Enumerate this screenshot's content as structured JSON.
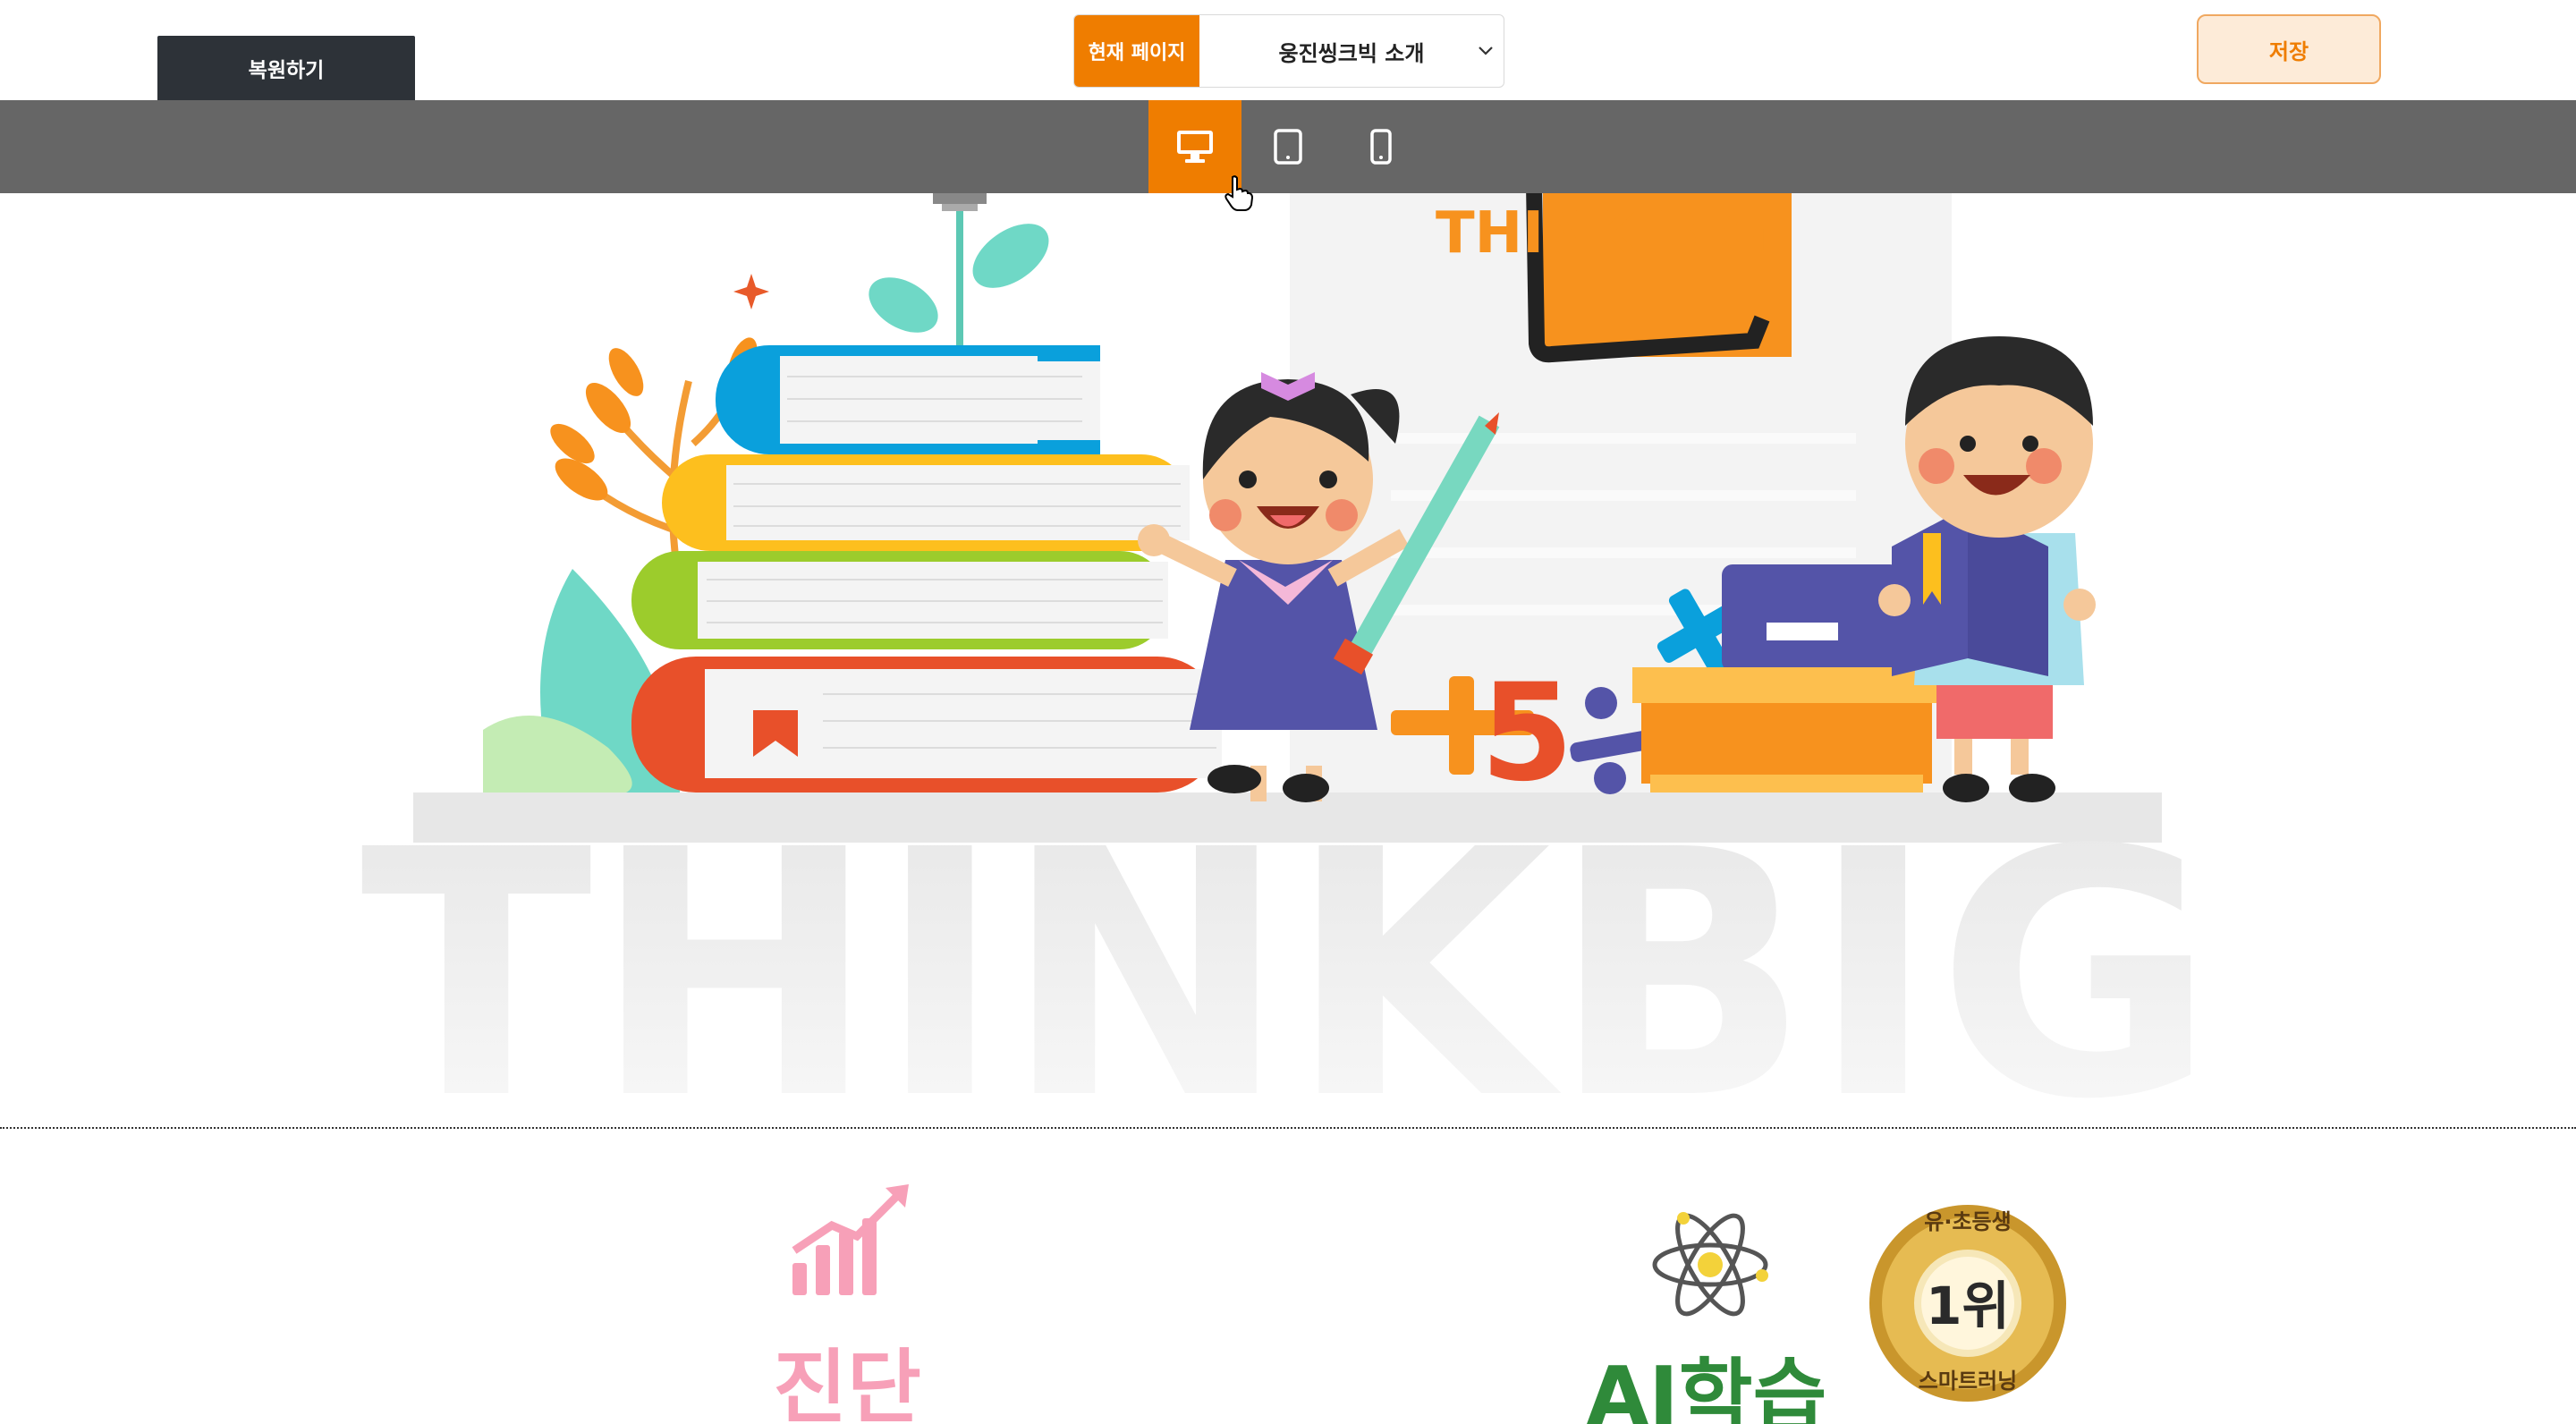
{
  "toolbar": {
    "restore_label": "복원하기",
    "current_page_label": "현재 페이지",
    "current_page_value": "웅진씽크빅 소개",
    "save_label": "저장"
  },
  "device_switcher": {
    "active": "desktop",
    "items": [
      {
        "name": "desktop",
        "icon": "desktop-icon"
      },
      {
        "name": "tablet",
        "icon": "tablet-icon"
      },
      {
        "name": "mobile",
        "icon": "mobile-icon"
      }
    ]
  },
  "hero": {
    "sign_text": "THINK BIG",
    "floor_text": "THINKBIG",
    "math_number": "5"
  },
  "features": {
    "diagnosis_text": "진단",
    "ai_text": "AI학습",
    "badge_top": "유·초등생",
    "badge_rank": "1위",
    "badge_bottom": "스마트러닝"
  },
  "colors": {
    "accent": "#ef7d00",
    "dark_button": "#2d3238",
    "device_bar": "#666666",
    "save_bg": "#fdebd8"
  }
}
